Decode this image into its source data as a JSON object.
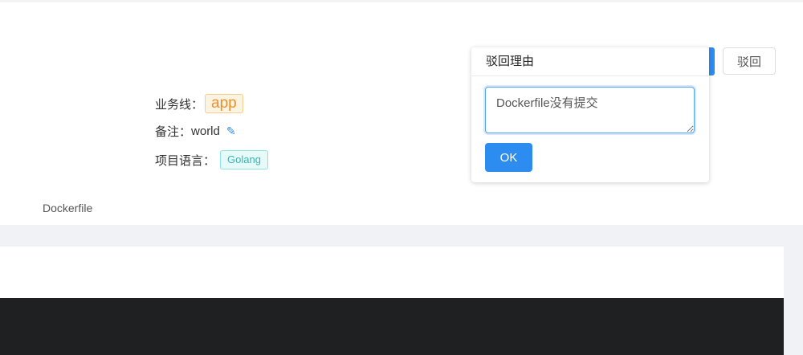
{
  "info": {
    "business_label": "业务线：",
    "business_value": "app",
    "note_label": "备注：",
    "note_value": "world",
    "lang_label": "项目语言：",
    "lang_value": "Golang"
  },
  "tabs": {
    "dockerfile": "Dockerfile"
  },
  "reject_button": "驳回",
  "popover": {
    "title": "驳回理由",
    "reason": "Dockerfile没有提交",
    "ok": "OK"
  },
  "colors": {
    "primary": "#2d8cf0",
    "app_tag": "#e8912f",
    "lang_tag": "#3bb5b0"
  }
}
